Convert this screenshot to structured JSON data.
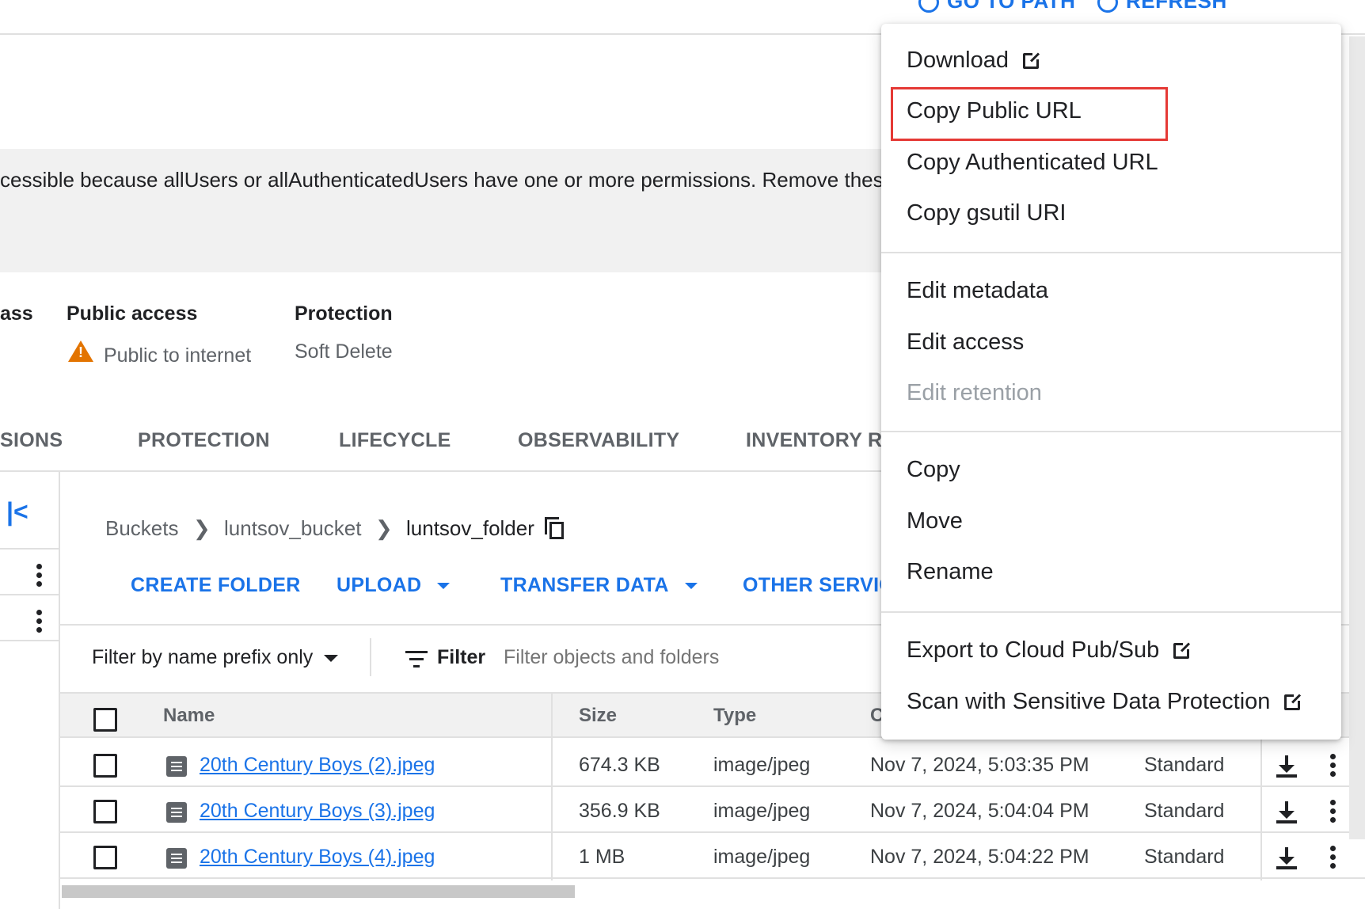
{
  "topbar": {
    "go_to_path": "GO TO PATH",
    "refresh": "REFRESH"
  },
  "banner": {
    "text": "cessible because allUsers or allAuthenticatedUsers have one or more permissions. Remove these"
  },
  "overview": {
    "class_label_partial": "ass",
    "public_access_label": "Public access",
    "public_access_value": "Public to internet",
    "protection_label": "Protection",
    "protection_value": "Soft Delete"
  },
  "tabs": [
    "SIONS",
    "PROTECTION",
    "LIFECYCLE",
    "OBSERVABILITY",
    "INVENTORY RE"
  ],
  "breadcrumb": {
    "root": "Buckets",
    "bucket": "luntsov_bucket",
    "folder": "luntsov_folder"
  },
  "actions": {
    "create_folder": "CREATE FOLDER",
    "upload": "UPLOAD",
    "transfer_data": "TRANSFER DATA",
    "other_services": "OTHER SERVIC"
  },
  "filter": {
    "mode": "Filter by name prefix only",
    "label": "Filter",
    "placeholder": "Filter objects and folders"
  },
  "table": {
    "headers": {
      "name": "Name",
      "size": "Size",
      "type": "Type",
      "created": "Cr"
    },
    "rows": [
      {
        "name": "20th Century Boys (2).jpeg",
        "size": "674.3 KB",
        "type": "image/jpeg",
        "created": "Nov 7, 2024, 5:03:35 PM",
        "storage_class": "Standard"
      },
      {
        "name": "20th Century Boys (3).jpeg",
        "size": "356.9 KB",
        "type": "image/jpeg",
        "created": "Nov 7, 2024, 5:04:04 PM",
        "storage_class": "Standard"
      },
      {
        "name": "20th Century Boys (4).jpeg",
        "size": "1 MB",
        "type": "image/jpeg",
        "created": "Nov 7, 2024, 5:04:22 PM",
        "storage_class": "Standard"
      }
    ]
  },
  "context_menu": {
    "download": "Download",
    "copy_public_url": "Copy Public URL",
    "copy_authenticated_url": "Copy Authenticated URL",
    "copy_gsutil_uri": "Copy gsutil URI",
    "edit_metadata": "Edit metadata",
    "edit_access": "Edit access",
    "edit_retention": "Edit retention",
    "copy": "Copy",
    "move": "Move",
    "rename": "Rename",
    "export_pubsub": "Export to Cloud Pub/Sub",
    "scan_sdp": "Scan with Sensitive Data Protection"
  },
  "colors": {
    "accent": "#1a73e8",
    "warning": "#e37400",
    "highlight": "#e53935"
  }
}
